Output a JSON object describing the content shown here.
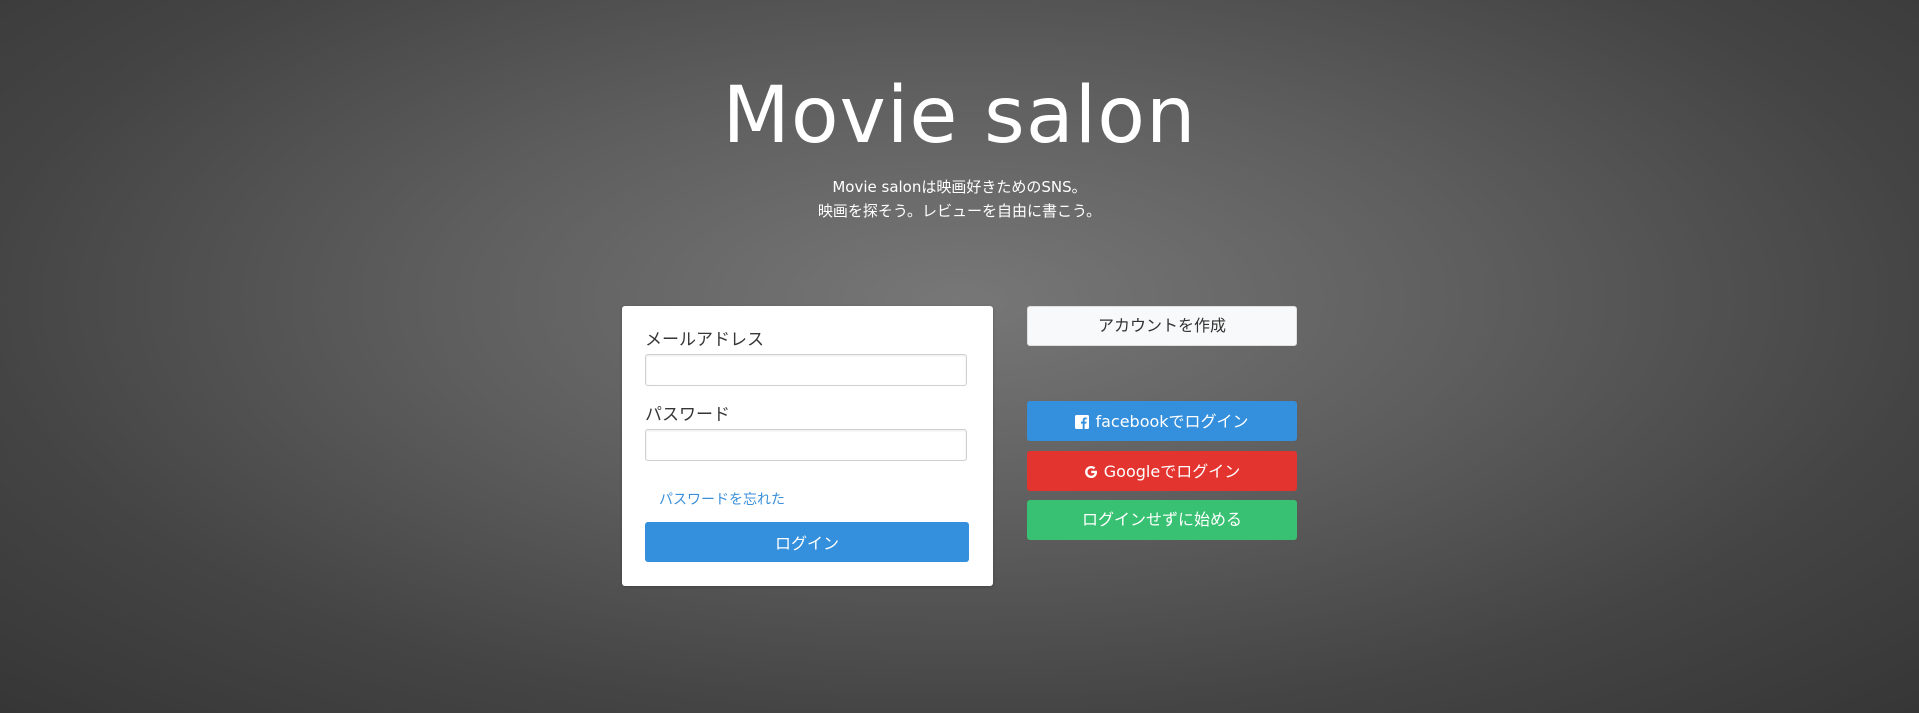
{
  "hero": {
    "title": "Movie salon",
    "subtitle_line1": "Movie salonは映画好きためのSNS。",
    "subtitle_line2": "映画を探そう。レビューを自由に書こう。"
  },
  "login_form": {
    "email_label": "メールアドレス",
    "email_value": "",
    "password_label": "パスワード",
    "password_value": "",
    "forgot_password": "パスワードを忘れた",
    "login_button": "ログイン"
  },
  "side_actions": {
    "create_account": "アカウントを作成",
    "facebook_login": "facebookでログイン",
    "google_login": "Googleでログイン",
    "guest_start": "ログインせずに始める"
  },
  "icons": {
    "facebook": "facebook-icon",
    "google": "google-icon"
  },
  "colors": {
    "primary": "#3490dc",
    "danger": "#e3342f",
    "success": "#38c172",
    "light": "#f8f9fa",
    "link": "#3b8fd9"
  }
}
